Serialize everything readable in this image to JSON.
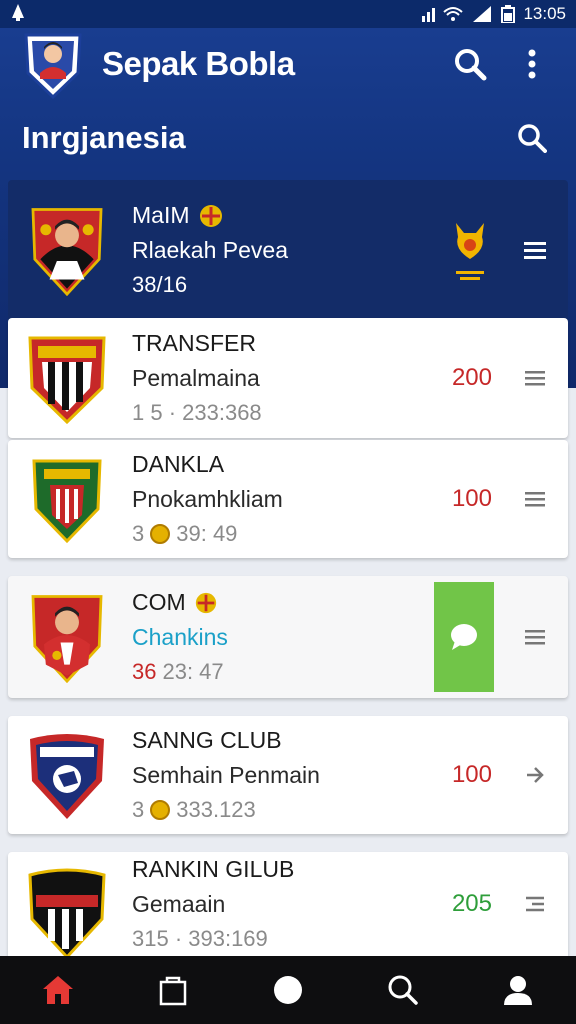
{
  "status": {
    "time": "13:05"
  },
  "app": {
    "title": "Sepak Bobla"
  },
  "section": {
    "title": "Inrgjanesia"
  },
  "featured": {
    "l1": "MaIM",
    "l2": "Rlaekah Pevea",
    "l3": "38/16"
  },
  "items": [
    {
      "l1": "TRANSFER",
      "l2": "Pemalmaina",
      "l3": "1 5 · 233:368",
      "score": "200",
      "score_color": "red",
      "trail": "menu"
    },
    {
      "l1": "DANKLA",
      "l2": "Pnokamhkliam",
      "l3": "39: 49",
      "l3_prefix": "3",
      "score": "100",
      "score_color": "red",
      "trail": "menu"
    },
    {
      "l1": "COM",
      "l2": "Chankins",
      "l3": "23: 47",
      "l3_prefix": "36",
      "score": "",
      "trail": "menu"
    },
    {
      "l1": "SANNG CLUB",
      "l2": "Semhain Penmain",
      "l3": "333.123",
      "l3_prefix": "3",
      "score": "100",
      "score_color": "red",
      "trail": "arrow"
    },
    {
      "l1": "RANKIN GILUB",
      "l2": "Gemaain",
      "l3": "315 · 393:169",
      "score": "205",
      "score_color": "green",
      "trail": "expand"
    }
  ],
  "colors": {
    "header": "#143581",
    "accent_red": "#c62828",
    "accent_green": "#2e9e3a",
    "panel_green": "#71c548"
  }
}
